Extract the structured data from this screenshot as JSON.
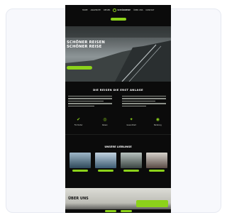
{
  "nav": {
    "items": [
      "HOME",
      "ANGEBOTE",
      "REISEN"
    ],
    "items_right": [
      "ÜBER UNS",
      "KONTAKT"
    ],
    "logo_text": "SCHÖNREISE",
    "cta_label": ""
  },
  "hero": {
    "title": "SCHÖNER REISEN SCHÖNER REISE",
    "subtitle": "",
    "button_label": ""
  },
  "about": {
    "kicker": "",
    "title": "DIE REISEN DIE ERST ANLAGE"
  },
  "features": [
    {
      "icon": "check-icon",
      "glyph": "✔",
      "label": "Für Kinder"
    },
    {
      "icon": "globe-icon",
      "glyph": "◎",
      "label": "Reisen"
    },
    {
      "icon": "star-icon",
      "glyph": "✦",
      "label": "Gesundheit"
    },
    {
      "icon": "location-icon",
      "glyph": "◉",
      "label": "Beratung"
    }
  ],
  "destinations": {
    "title": "UNSERE LIEBLINGE",
    "items": [
      {
        "color_top": "#9fb7c9",
        "color_bottom": "#2f4a5a"
      },
      {
        "color_top": "#c2d3e0",
        "color_bottom": "#3c5b73"
      },
      {
        "color_top": "#b8c2bf",
        "color_bottom": "#3b4642"
      },
      {
        "color_top": "#d6d2cc",
        "color_bottom": "#5a4b45"
      }
    ]
  },
  "footer": {
    "title": "ÜBER UNS",
    "chat_label": ""
  },
  "colors": {
    "accent": "#8cd21a",
    "background": "#0b0b0b"
  }
}
